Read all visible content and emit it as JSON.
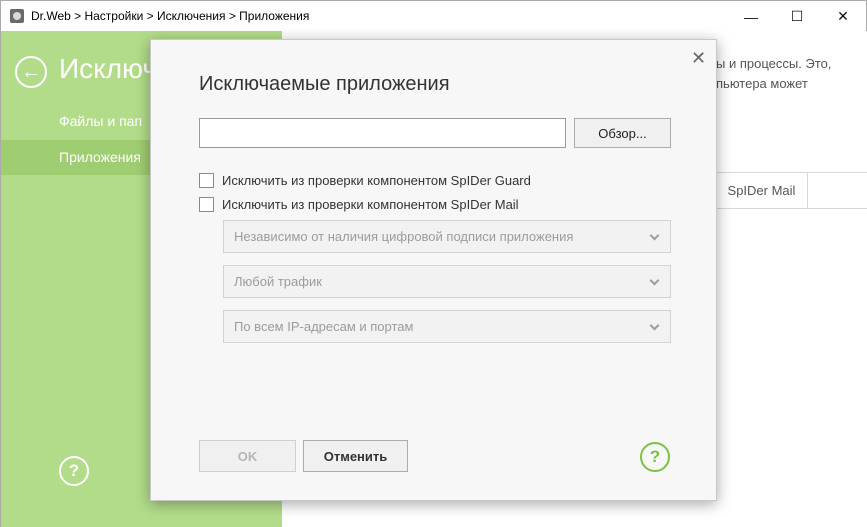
{
  "window": {
    "title": "Dr.Web > Настройки > Исключения > Приложения",
    "minimize_glyph": "—",
    "maximize_glyph": "☐",
    "close_glyph": "✕"
  },
  "sidebar": {
    "back_glyph": "←",
    "title": "Исключ",
    "items": [
      {
        "label": "Файлы и пап"
      },
      {
        "label": "Приложения"
      }
    ],
    "help_glyph": "?"
  },
  "main": {
    "description_line1": "ы и процессы. Это,",
    "description_line2": "пьютера может",
    "tab_label": "SpIDer Mail"
  },
  "dialog": {
    "close_glyph": "✕",
    "title": "Исключаемые приложения",
    "path_value": "",
    "browse_label": "Обзор...",
    "checkboxes": [
      {
        "label": "Исключить из проверки компонентом SpIDer Guard",
        "checked": false
      },
      {
        "label": "Исключить из проверки компонентом SpIDer Mail",
        "checked": false
      }
    ],
    "selects": [
      {
        "value": "Независимо от наличия цифровой подписи приложения"
      },
      {
        "value": "Любой трафик"
      },
      {
        "value": "По всем IP-адресам и портам"
      }
    ],
    "ok_label": "OK",
    "cancel_label": "Отменить",
    "help_glyph": "?"
  },
  "colors": {
    "sidebar_bg": "#b3dc8a",
    "sidebar_selected": "#9fce72",
    "accent_green": "#7cc242"
  }
}
